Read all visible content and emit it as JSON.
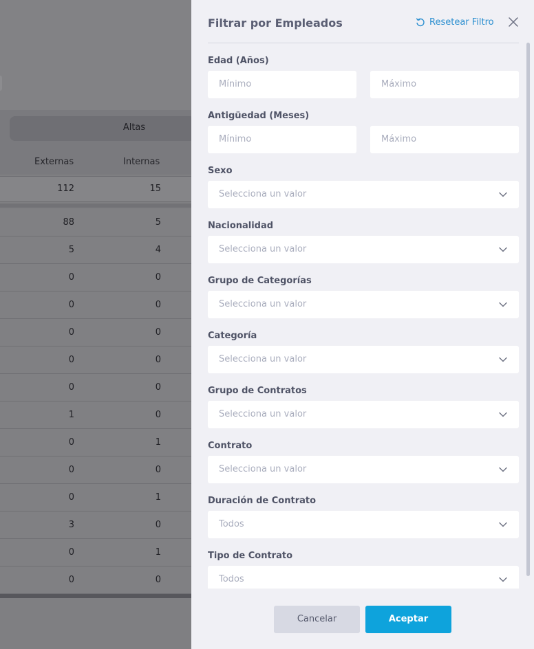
{
  "background": {
    "tab_label": "Altas",
    "columns": [
      "Externas",
      "Internas"
    ],
    "total_row": [
      "112",
      "15"
    ],
    "rows": [
      [
        "88",
        "5"
      ],
      [
        "5",
        "4"
      ],
      [
        "0",
        "0"
      ],
      [
        "0",
        "0"
      ],
      [
        "0",
        "0"
      ],
      [
        "0",
        "0"
      ],
      [
        "0",
        "0"
      ],
      [
        "1",
        "0"
      ],
      [
        "0",
        "1"
      ],
      [
        "0",
        "0"
      ],
      [
        "0",
        "1"
      ],
      [
        "3",
        "0"
      ],
      [
        "0",
        "1"
      ],
      [
        "0",
        "0"
      ]
    ]
  },
  "drawer": {
    "title": "Filtrar por Empleados",
    "reset_label": "Resetear Filtro",
    "fields": {
      "edad": {
        "label": "Edad (Años)",
        "min_placeholder": "Mínimo",
        "max_placeholder": "Máximo"
      },
      "antiguedad": {
        "label": "Antigüedad (Meses)",
        "min_placeholder": "Mínimo",
        "max_placeholder": "Máximo"
      },
      "sexo": {
        "label": "Sexo",
        "value": "Selecciona un valor"
      },
      "nacionalidad": {
        "label": "Nacionalidad",
        "value": "Selecciona un valor"
      },
      "grupo_categorias": {
        "label": "Grupo de Categorías",
        "value": "Selecciona un valor"
      },
      "categoria": {
        "label": "Categoría",
        "value": "Selecciona un valor"
      },
      "grupo_contratos": {
        "label": "Grupo de Contratos",
        "value": "Selecciona un valor"
      },
      "contrato": {
        "label": "Contrato",
        "value": "Selecciona un valor"
      },
      "duracion_contrato": {
        "label": "Duración de Contrato",
        "value": "Todos"
      },
      "tipo_contrato": {
        "label": "Tipo de Contrato",
        "value": "Todos"
      }
    },
    "cancel_label": "Cancelar",
    "accept_label": "Aceptar"
  },
  "colors": {
    "accent": "#0ea3dc",
    "link": "#2b8fd0",
    "panel_bg": "#f0f0f5",
    "overlay": "#7f7f82"
  },
  "icons": {
    "reset": "refresh-icon",
    "close": "close-icon",
    "dropdown": "chevron-down-icon"
  }
}
